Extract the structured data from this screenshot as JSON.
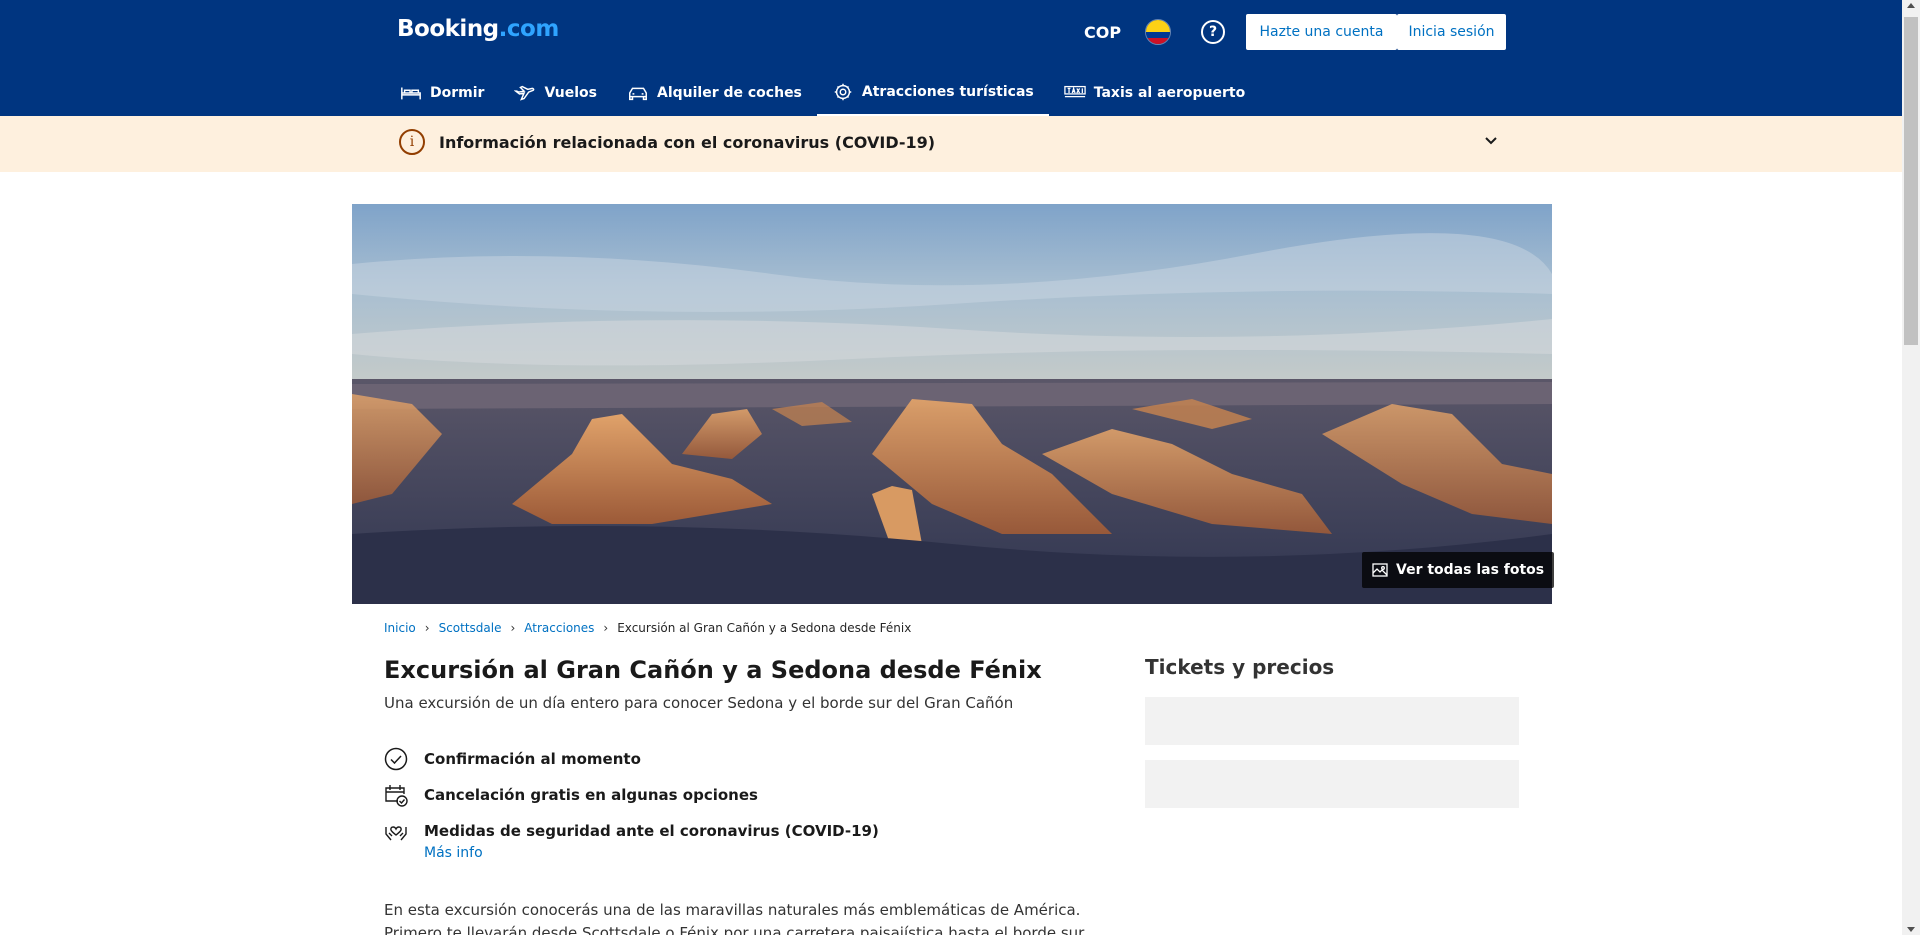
{
  "header": {
    "logo": {
      "main": "Booking",
      "suffix": ".com"
    },
    "currency": "COP",
    "flag": "colombia-flag",
    "help_icon": "?",
    "register_label": "Hazte una cuenta",
    "login_label": "Inicia sesión",
    "colors": {
      "brand": "#003580",
      "link": "#0071c2"
    }
  },
  "nav": {
    "items": [
      {
        "label": "Dormir",
        "icon": "bed-icon"
      },
      {
        "label": "Vuelos",
        "icon": "plane-icon"
      },
      {
        "label": "Alquiler de coches",
        "icon": "car-icon"
      },
      {
        "label": "Atracciones turísticas",
        "icon": "attractions-icon",
        "active": true
      },
      {
        "label": "Taxis al aeropuerto",
        "icon": "taxi-icon"
      }
    ]
  },
  "covid_banner": {
    "text": "Información relacionada con el coronavirus (COVID-19)",
    "icon": "i",
    "bg_color": "#fef0de"
  },
  "hero": {
    "photos_label": "Ver todas las fotos"
  },
  "breadcrumb": {
    "items": [
      "Inicio",
      "Scottsdale",
      "Atracciones"
    ],
    "current": "Excursión al Gran Cañón y a Sedona desde Fénix",
    "separator": "›"
  },
  "main": {
    "title": "Excursión al Gran Cañón y a Sedona desde Fénix",
    "subtitle": "Una excursión de un día entero para conocer Sedona y el borde sur del Gran Cañón",
    "features": [
      {
        "label": "Confirmación al momento",
        "icon": "checkmark-circle-icon"
      },
      {
        "label": "Cancelación gratis en algunas opciones",
        "icon": "calendar-check-icon"
      },
      {
        "label": "Medidas de seguridad ante el coronavirus (COVID-19)",
        "icon": "heart-hands-icon"
      }
    ],
    "more_info": "Más info",
    "description": "En esta excursión conocerás una de las maravillas naturales más emblemáticas de América. Primero te llevarán desde Scottsdale o Fénix por una carretera paisajística hasta el borde sur del Gran Cañón y a"
  },
  "sidebar": {
    "title": "Tickets y precios"
  }
}
